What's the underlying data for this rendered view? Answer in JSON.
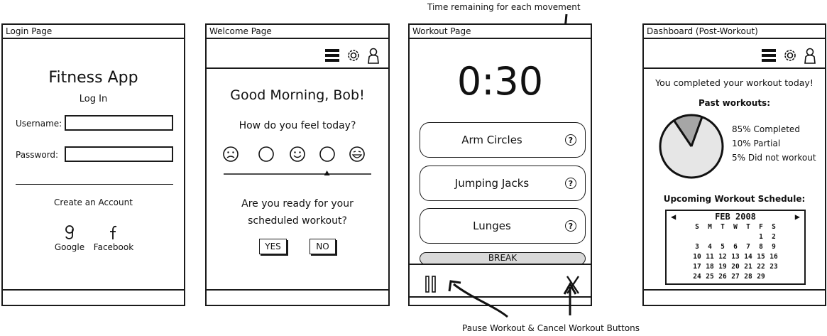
{
  "annotations": {
    "top": "Time remaining for each movement",
    "bottom": "Pause Workout & Cancel Workout Buttons"
  },
  "login": {
    "frame_title": "Login Page",
    "app_name": "Fitness App",
    "heading": "Log In",
    "username_label": "Username:",
    "password_label": "Password:",
    "username_value": "",
    "password_value": "",
    "create_account": "Create an Account",
    "google_label": "Google",
    "facebook_label": "Facebook"
  },
  "welcome": {
    "frame_title": "Welcome Page",
    "greeting": "Good Morning, Bob!",
    "question": "How do you feel today?",
    "mood_slider_value": 0.7,
    "ready_line1": "Are you ready for your",
    "ready_line2": "scheduled workout?",
    "yes_label": "YES",
    "no_label": "NO"
  },
  "workout": {
    "frame_title": "Workout Page",
    "timer": "0:30",
    "movements": [
      "Arm Circles",
      "Jumping Jacks",
      "Lunges"
    ],
    "help_glyph": "?",
    "break_label": "BREAK"
  },
  "dashboard": {
    "frame_title": "Dashboard (Post-Workout)",
    "completed_msg": "You completed your workout today!",
    "past_heading": "Past workouts:",
    "legend": [
      "85% Completed",
      "10% Partial",
      "5% Did not workout"
    ],
    "upcoming_heading": "Upcoming Workout Schedule:",
    "calendar": {
      "month": "FEB",
      "year": "2008",
      "weekdays": [
        "S",
        "M",
        "T",
        "W",
        "T",
        "F",
        "S"
      ],
      "weeks": [
        [
          "",
          "",
          "",
          "",
          "",
          "1",
          "2"
        ],
        [
          "3",
          "4",
          "5",
          "6",
          "7",
          "8",
          "9"
        ],
        [
          "10",
          "11",
          "12",
          "13",
          "14",
          "15",
          "16"
        ],
        [
          "17",
          "18",
          "19",
          "20",
          "21",
          "22",
          "23"
        ],
        [
          "24",
          "25",
          "26",
          "27",
          "28",
          "29",
          ""
        ]
      ]
    }
  },
  "chart_data": {
    "type": "pie",
    "categories": [
      "Completed",
      "Partial",
      "Did not workout"
    ],
    "values": [
      85,
      10,
      5
    ],
    "colors": [
      "#e6e6e6",
      "#a6a6a6",
      "#a6a6a6"
    ]
  }
}
